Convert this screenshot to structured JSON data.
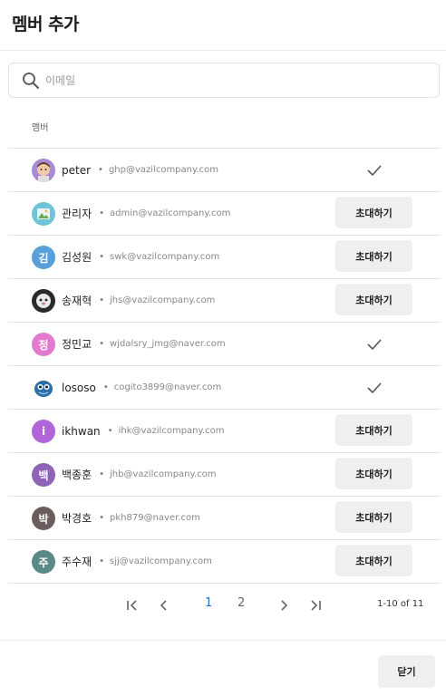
{
  "dialog": {
    "title": "멤버 추가"
  },
  "search": {
    "placeholder": "이메일",
    "value": ""
  },
  "table": {
    "column_header": "멤버"
  },
  "invite_label": "초대하기",
  "members": [
    {
      "name": "peter",
      "email": "ghp@vazilcompany.com",
      "avatar_icon": "memoji-avatar",
      "invited": true
    },
    {
      "name": "관리자",
      "email": "admin@vazilcompany.com",
      "avatar_icon": "landscape-photo-avatar",
      "invited": false
    },
    {
      "name": "김성원",
      "email": "swk@vazilcompany.com",
      "avatar_letter": "김",
      "avatar_color": "#5aa0d8",
      "invited": false
    },
    {
      "name": "송재혁",
      "email": "jhs@vazilcompany.com",
      "avatar_icon": "photo-avatar",
      "invited": false
    },
    {
      "name": "정민교",
      "email": "wjdalsry_jmg@naver.com",
      "avatar_letter": "정",
      "avatar_color": "#e27bcf",
      "invited": true
    },
    {
      "name": "lososo",
      "email": "cogito3899@naver.com",
      "avatar_icon": "creature-avatar",
      "invited": true
    },
    {
      "name": "ikhwan",
      "email": "ihk@vazilcompany.com",
      "avatar_letter": "i",
      "avatar_color": "#b066d9",
      "invited": false
    },
    {
      "name": "백종훈",
      "email": "jhb@vazilcompany.com",
      "avatar_letter": "백",
      "avatar_color": "#8e63b8",
      "invited": false
    },
    {
      "name": "박경호",
      "email": "pkh879@naver.com",
      "avatar_letter": "박",
      "avatar_color": "#6b5d5d",
      "invited": false
    },
    {
      "name": "주수재",
      "email": "sjj@vazilcompany.com",
      "avatar_letter": "주",
      "avatar_color": "#5a8a85",
      "invited": false
    }
  ],
  "pagination": {
    "pages": [
      "1",
      "2"
    ],
    "current_page": "1",
    "range_label": "1-10 of 11"
  },
  "footer": {
    "close_label": "닫기"
  },
  "colors": {
    "accent": "#1f6fd1",
    "button_bg": "#efefef",
    "divider": "#e3e3e3"
  }
}
